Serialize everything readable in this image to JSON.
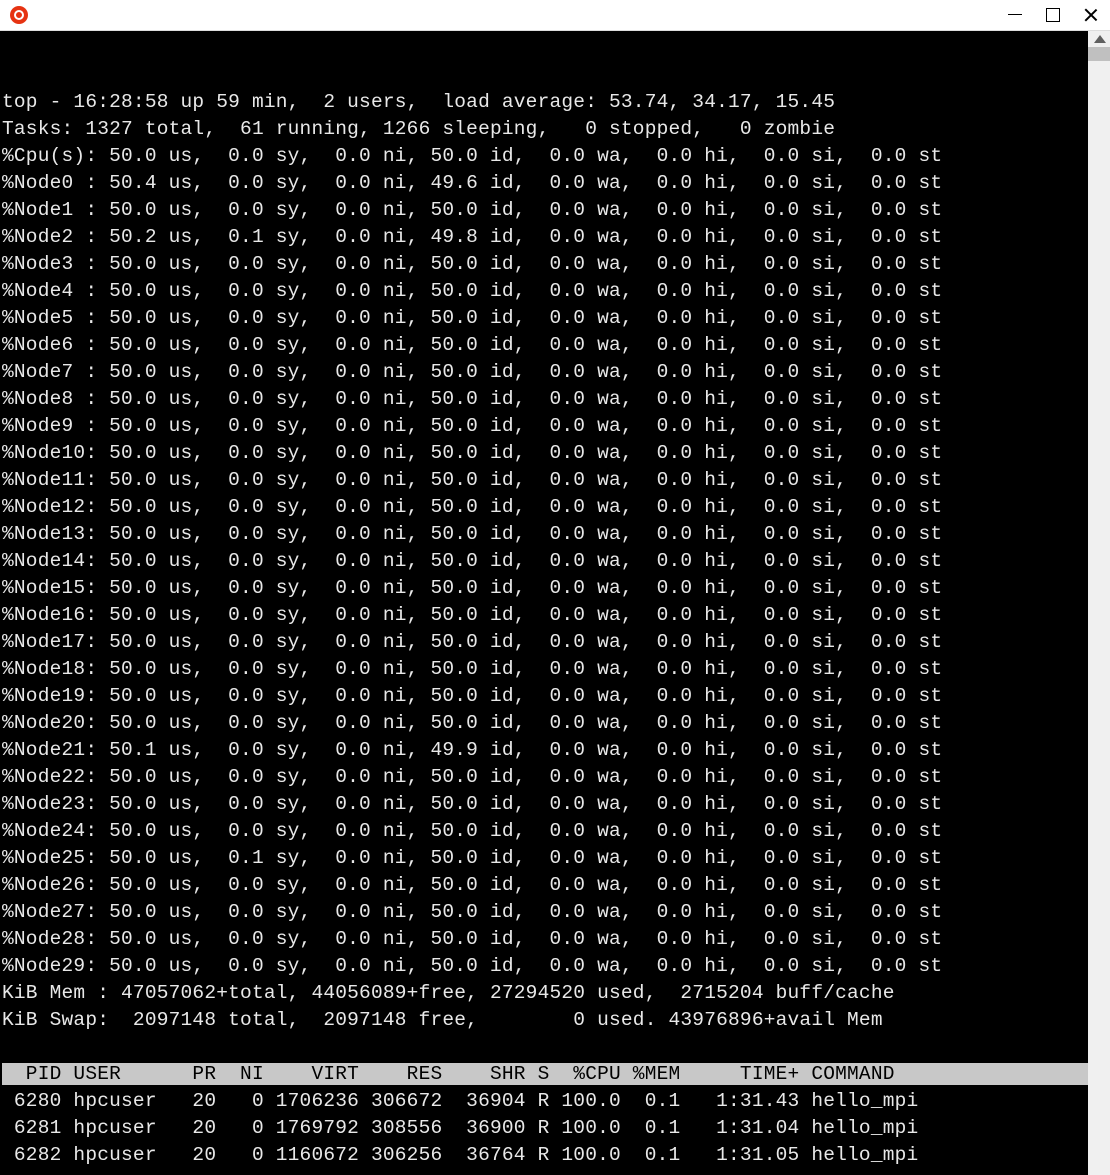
{
  "window": {
    "app_icon_name": "app-icon"
  },
  "summary": {
    "line1": "top - 16:28:58 up 59 min,  2 users,  load average: 53.74, 34.17, 15.45",
    "line2": "Tasks: 1327 total,  61 running, 1266 sleeping,   0 stopped,   0 zombie",
    "cpu": "%Cpu(s): 50.0 us,  0.0 sy,  0.0 ni, 50.0 id,  0.0 wa,  0.0 hi,  0.0 si,  0.0 st"
  },
  "nodes": [
    {
      "label": "%Node0 ",
      "us": "50.4",
      "sy": "0.0",
      "ni": "0.0",
      "id": "49.6",
      "wa": "0.0",
      "hi": "0.0",
      "si": "0.0",
      "st": "0.0"
    },
    {
      "label": "%Node1 ",
      "us": "50.0",
      "sy": "0.0",
      "ni": "0.0",
      "id": "50.0",
      "wa": "0.0",
      "hi": "0.0",
      "si": "0.0",
      "st": "0.0"
    },
    {
      "label": "%Node2 ",
      "us": "50.2",
      "sy": "0.1",
      "ni": "0.0",
      "id": "49.8",
      "wa": "0.0",
      "hi": "0.0",
      "si": "0.0",
      "st": "0.0"
    },
    {
      "label": "%Node3 ",
      "us": "50.0",
      "sy": "0.0",
      "ni": "0.0",
      "id": "50.0",
      "wa": "0.0",
      "hi": "0.0",
      "si": "0.0",
      "st": "0.0"
    },
    {
      "label": "%Node4 ",
      "us": "50.0",
      "sy": "0.0",
      "ni": "0.0",
      "id": "50.0",
      "wa": "0.0",
      "hi": "0.0",
      "si": "0.0",
      "st": "0.0"
    },
    {
      "label": "%Node5 ",
      "us": "50.0",
      "sy": "0.0",
      "ni": "0.0",
      "id": "50.0",
      "wa": "0.0",
      "hi": "0.0",
      "si": "0.0",
      "st": "0.0"
    },
    {
      "label": "%Node6 ",
      "us": "50.0",
      "sy": "0.0",
      "ni": "0.0",
      "id": "50.0",
      "wa": "0.0",
      "hi": "0.0",
      "si": "0.0",
      "st": "0.0"
    },
    {
      "label": "%Node7 ",
      "us": "50.0",
      "sy": "0.0",
      "ni": "0.0",
      "id": "50.0",
      "wa": "0.0",
      "hi": "0.0",
      "si": "0.0",
      "st": "0.0"
    },
    {
      "label": "%Node8 ",
      "us": "50.0",
      "sy": "0.0",
      "ni": "0.0",
      "id": "50.0",
      "wa": "0.0",
      "hi": "0.0",
      "si": "0.0",
      "st": "0.0"
    },
    {
      "label": "%Node9 ",
      "us": "50.0",
      "sy": "0.0",
      "ni": "0.0",
      "id": "50.0",
      "wa": "0.0",
      "hi": "0.0",
      "si": "0.0",
      "st": "0.0"
    },
    {
      "label": "%Node10",
      "us": "50.0",
      "sy": "0.0",
      "ni": "0.0",
      "id": "50.0",
      "wa": "0.0",
      "hi": "0.0",
      "si": "0.0",
      "st": "0.0"
    },
    {
      "label": "%Node11",
      "us": "50.0",
      "sy": "0.0",
      "ni": "0.0",
      "id": "50.0",
      "wa": "0.0",
      "hi": "0.0",
      "si": "0.0",
      "st": "0.0"
    },
    {
      "label": "%Node12",
      "us": "50.0",
      "sy": "0.0",
      "ni": "0.0",
      "id": "50.0",
      "wa": "0.0",
      "hi": "0.0",
      "si": "0.0",
      "st": "0.0"
    },
    {
      "label": "%Node13",
      "us": "50.0",
      "sy": "0.0",
      "ni": "0.0",
      "id": "50.0",
      "wa": "0.0",
      "hi": "0.0",
      "si": "0.0",
      "st": "0.0"
    },
    {
      "label": "%Node14",
      "us": "50.0",
      "sy": "0.0",
      "ni": "0.0",
      "id": "50.0",
      "wa": "0.0",
      "hi": "0.0",
      "si": "0.0",
      "st": "0.0"
    },
    {
      "label": "%Node15",
      "us": "50.0",
      "sy": "0.0",
      "ni": "0.0",
      "id": "50.0",
      "wa": "0.0",
      "hi": "0.0",
      "si": "0.0",
      "st": "0.0"
    },
    {
      "label": "%Node16",
      "us": "50.0",
      "sy": "0.0",
      "ni": "0.0",
      "id": "50.0",
      "wa": "0.0",
      "hi": "0.0",
      "si": "0.0",
      "st": "0.0"
    },
    {
      "label": "%Node17",
      "us": "50.0",
      "sy": "0.0",
      "ni": "0.0",
      "id": "50.0",
      "wa": "0.0",
      "hi": "0.0",
      "si": "0.0",
      "st": "0.0"
    },
    {
      "label": "%Node18",
      "us": "50.0",
      "sy": "0.0",
      "ni": "0.0",
      "id": "50.0",
      "wa": "0.0",
      "hi": "0.0",
      "si": "0.0",
      "st": "0.0"
    },
    {
      "label": "%Node19",
      "us": "50.0",
      "sy": "0.0",
      "ni": "0.0",
      "id": "50.0",
      "wa": "0.0",
      "hi": "0.0",
      "si": "0.0",
      "st": "0.0"
    },
    {
      "label": "%Node20",
      "us": "50.0",
      "sy": "0.0",
      "ni": "0.0",
      "id": "50.0",
      "wa": "0.0",
      "hi": "0.0",
      "si": "0.0",
      "st": "0.0"
    },
    {
      "label": "%Node21",
      "us": "50.1",
      "sy": "0.0",
      "ni": "0.0",
      "id": "49.9",
      "wa": "0.0",
      "hi": "0.0",
      "si": "0.0",
      "st": "0.0"
    },
    {
      "label": "%Node22",
      "us": "50.0",
      "sy": "0.0",
      "ni": "0.0",
      "id": "50.0",
      "wa": "0.0",
      "hi": "0.0",
      "si": "0.0",
      "st": "0.0"
    },
    {
      "label": "%Node23",
      "us": "50.0",
      "sy": "0.0",
      "ni": "0.0",
      "id": "50.0",
      "wa": "0.0",
      "hi": "0.0",
      "si": "0.0",
      "st": "0.0"
    },
    {
      "label": "%Node24",
      "us": "50.0",
      "sy": "0.0",
      "ni": "0.0",
      "id": "50.0",
      "wa": "0.0",
      "hi": "0.0",
      "si": "0.0",
      "st": "0.0"
    },
    {
      "label": "%Node25",
      "us": "50.0",
      "sy": "0.1",
      "ni": "0.0",
      "id": "50.0",
      "wa": "0.0",
      "hi": "0.0",
      "si": "0.0",
      "st": "0.0"
    },
    {
      "label": "%Node26",
      "us": "50.0",
      "sy": "0.0",
      "ni": "0.0",
      "id": "50.0",
      "wa": "0.0",
      "hi": "0.0",
      "si": "0.0",
      "st": "0.0"
    },
    {
      "label": "%Node27",
      "us": "50.0",
      "sy": "0.0",
      "ni": "0.0",
      "id": "50.0",
      "wa": "0.0",
      "hi": "0.0",
      "si": "0.0",
      "st": "0.0"
    },
    {
      "label": "%Node28",
      "us": "50.0",
      "sy": "0.0",
      "ni": "0.0",
      "id": "50.0",
      "wa": "0.0",
      "hi": "0.0",
      "si": "0.0",
      "st": "0.0"
    },
    {
      "label": "%Node29",
      "us": "50.0",
      "sy": "0.0",
      "ni": "0.0",
      "id": "50.0",
      "wa": "0.0",
      "hi": "0.0",
      "si": "0.0",
      "st": "0.0"
    }
  ],
  "mem": {
    "line1": "KiB Mem : 47057062+total, 44056089+free, 27294520 used,  2715204 buff/cache",
    "line2": "KiB Swap:  2097148 total,  2097148 free,        0 used. 43976896+avail Mem"
  },
  "proc_header": "  PID USER      PR  NI    VIRT    RES    SHR S  %CPU %MEM     TIME+ COMMAND                   ",
  "processes": [
    {
      "PID": "6280",
      "USER": "hpcuser",
      "PR": "20",
      "NI": "0",
      "VIRT": "1706236",
      "RES": "306672",
      "SHR": "36904",
      "S": "R",
      "CPU": "100.0",
      "MEM": "0.1",
      "TIME": "1:31.43",
      "COMMAND": "hello_mpi"
    },
    {
      "PID": "6281",
      "USER": "hpcuser",
      "PR": "20",
      "NI": "0",
      "VIRT": "1769792",
      "RES": "308556",
      "SHR": "36900",
      "S": "R",
      "CPU": "100.0",
      "MEM": "0.1",
      "TIME": "1:31.04",
      "COMMAND": "hello_mpi"
    },
    {
      "PID": "6282",
      "USER": "hpcuser",
      "PR": "20",
      "NI": "0",
      "VIRT": "1160672",
      "RES": "306256",
      "SHR": "36764",
      "S": "R",
      "CPU": "100.0",
      "MEM": "0.1",
      "TIME": "1:31.05",
      "COMMAND": "hello_mpi"
    }
  ]
}
